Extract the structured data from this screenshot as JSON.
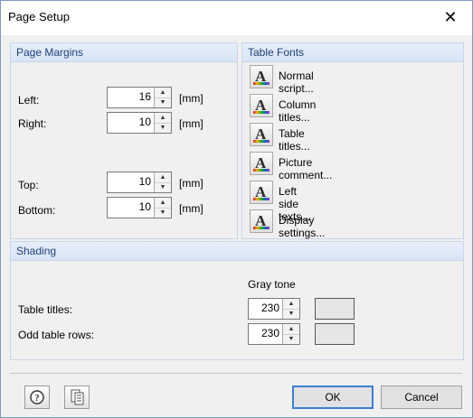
{
  "dialog": {
    "title": "Page Setup",
    "close_glyph": "✕"
  },
  "page_margins": {
    "heading": "Page Margins",
    "fields": [
      {
        "label": "Left:",
        "value": "16",
        "unit": "[mm]"
      },
      {
        "label": "Right:",
        "value": "10",
        "unit": "[mm]"
      },
      {
        "label": "Top:",
        "value": "10",
        "unit": "[mm]"
      },
      {
        "label": "Bottom:",
        "value": "10",
        "unit": "[mm]"
      }
    ]
  },
  "table_fonts": {
    "heading": "Table Fonts",
    "items": [
      {
        "label": "Normal script..."
      },
      {
        "label": "Column titles..."
      },
      {
        "label": "Table titles..."
      },
      {
        "label": "Picture comment..."
      },
      {
        "label": "Left side texts..."
      },
      {
        "label": "Display settings..."
      }
    ],
    "icon_glyph": "A"
  },
  "shading": {
    "heading": "Shading",
    "column_header": "Gray tone",
    "rows": [
      {
        "label": "Table titles:",
        "value": "230",
        "swatch_color": "#e6e6e6"
      },
      {
        "label": "Odd table rows:",
        "value": "230",
        "swatch_color": "#e6e6e6"
      }
    ]
  },
  "footer": {
    "help_icon": "help-icon",
    "defaults_icon": "page-settings-icon",
    "ok_label": "OK",
    "cancel_label": "Cancel"
  },
  "colors": {
    "group_header_text": "#1f3f7a",
    "group_header_bg": "#dde7f7",
    "default_button_border": "#3c7fd2"
  }
}
